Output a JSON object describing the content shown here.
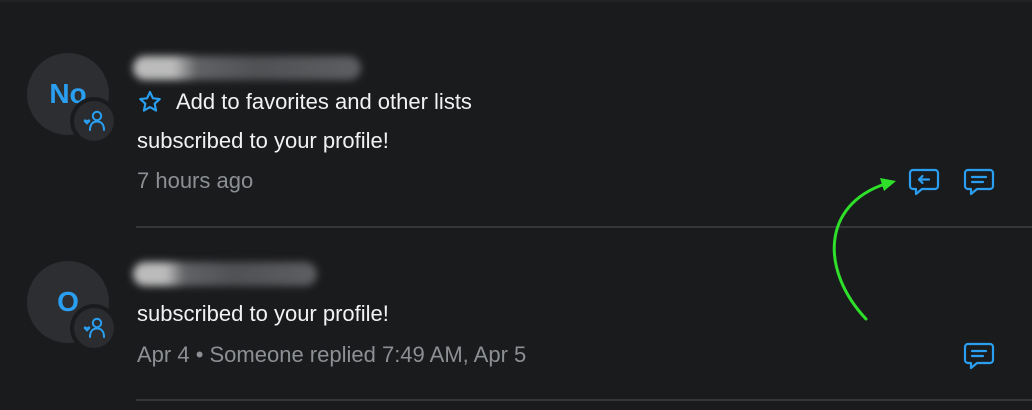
{
  "colors": {
    "background": "#1a1b1d",
    "accent": "#2a9ff2",
    "text": "#f2f2f2",
    "muted_text": "#8c8f94",
    "divider": "#34363a",
    "annotation_arrow": "#2ee02a"
  },
  "notifications": [
    {
      "avatar_initials": "No",
      "favorites_label": "Add to favorites and other lists",
      "message": "subscribed to your profile!",
      "meta": "7 hours ago",
      "actions": [
        "reply-quote-icon",
        "message-icon"
      ]
    },
    {
      "avatar_initials": "O",
      "message": "subscribed to your profile!",
      "meta": "Apr 4 • Someone replied 7:49 AM, Apr 5",
      "actions": [
        "message-icon"
      ]
    }
  ],
  "icons": {
    "favorite": "star-icon",
    "badge": "subscriber-icon"
  }
}
